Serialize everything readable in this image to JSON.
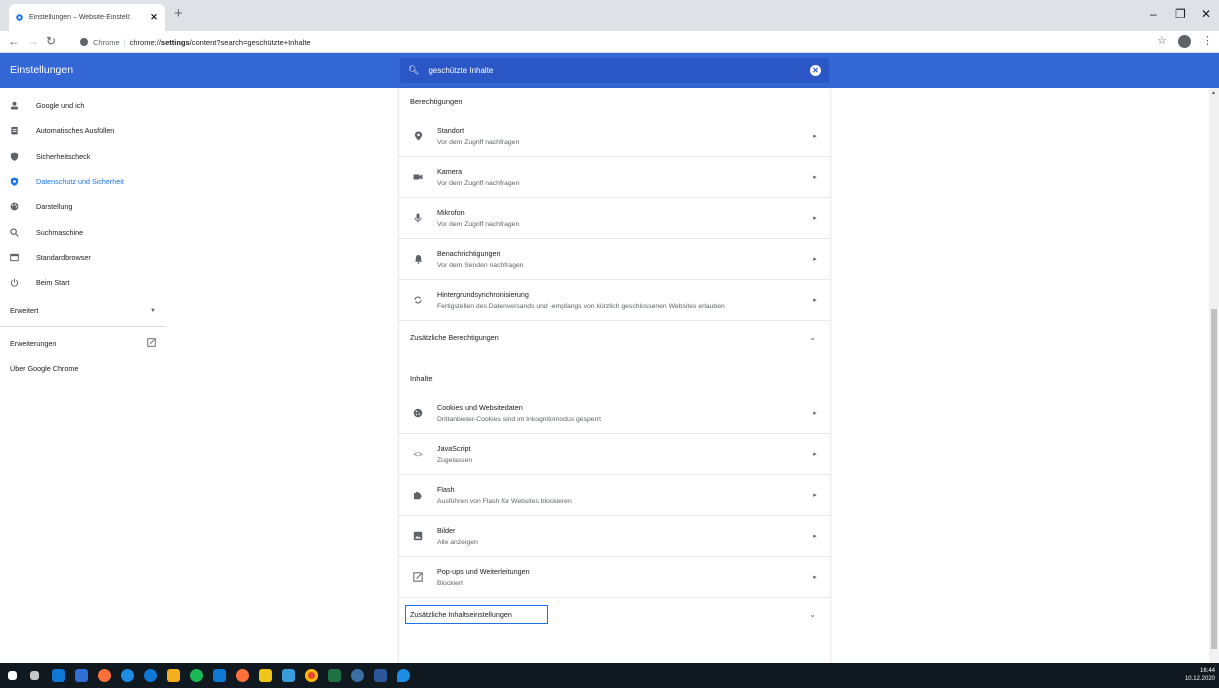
{
  "browser": {
    "tab_title": "Einstellungen – Website-Einstell:",
    "tab_close": "✕",
    "new_tab": "+",
    "omnibox_site": "Chrome",
    "omnibox_url_prefix": "chrome://",
    "omnibox_url_bold": "settings",
    "omnibox_url_rest": "/content?search=geschützte+Inhalte",
    "minimize": "–",
    "maximize": "❐",
    "close": "✕"
  },
  "header": {
    "title": "Einstellungen",
    "search_value": "geschützte Inhalte",
    "clear": "✕"
  },
  "sidebar": {
    "items": [
      {
        "label": "Google und ich",
        "icon": "person-icon"
      },
      {
        "label": "Automatisches Ausfüllen",
        "icon": "clipboard-icon"
      },
      {
        "label": "Sicherheitscheck",
        "icon": "shield-check-icon"
      },
      {
        "label": "Datenschutz und Sicherheit",
        "icon": "shield-icon"
      },
      {
        "label": "Darstellung",
        "icon": "palette-icon"
      },
      {
        "label": "Suchmaschine",
        "icon": "search-icon"
      },
      {
        "label": "Standardbrowser",
        "icon": "browser-icon"
      },
      {
        "label": "Beim Start",
        "icon": "power-icon"
      }
    ],
    "advanced": "Erweitert",
    "extensions": "Erweiterungen",
    "about": "Über Google Chrome"
  },
  "permissions": {
    "title": "Berechtigungen",
    "rows": [
      {
        "label": "Standort",
        "sub": "Vor dem Zugriff nachfragen"
      },
      {
        "label": "Kamera",
        "sub": "Vor dem Zugriff nachfragen"
      },
      {
        "label": "Mikrofon",
        "sub": "Vor dem Zugriff nachfragen"
      },
      {
        "label": "Benachrichtigungen",
        "sub": "Vor dem Senden nachfragen"
      },
      {
        "label": "Hintergrundsynchronisierung",
        "sub": "Fertigstellen des Datenversands und -empfangs von kürzlich geschlossenen Websites erlauben"
      }
    ],
    "more": "Zusätzliche Berechtigungen"
  },
  "content_settings": {
    "title": "Inhalte",
    "rows": [
      {
        "label": "Cookies und Websitedaten",
        "sub": "Drittanbieter-Cookies sind im Inkognitomodus gesperrt"
      },
      {
        "label": "JavaScript",
        "sub": "Zugelassen"
      },
      {
        "label": "Flash",
        "sub": "Ausführen von Flash für Websites blockieren"
      },
      {
        "label": "Bilder",
        "sub": "Alle anzeigen"
      },
      {
        "label": "Pop-ups und Weiterleitungen",
        "sub": "Blockiert"
      }
    ],
    "more": "Zusätzliche Inhaltseinstellungen"
  },
  "taskbar": {
    "time": "16:44",
    "date": "10.12.2020"
  },
  "colors": {
    "accent": "#3367d6",
    "link_active": "#1a73e8",
    "taskbar": "#101820"
  }
}
